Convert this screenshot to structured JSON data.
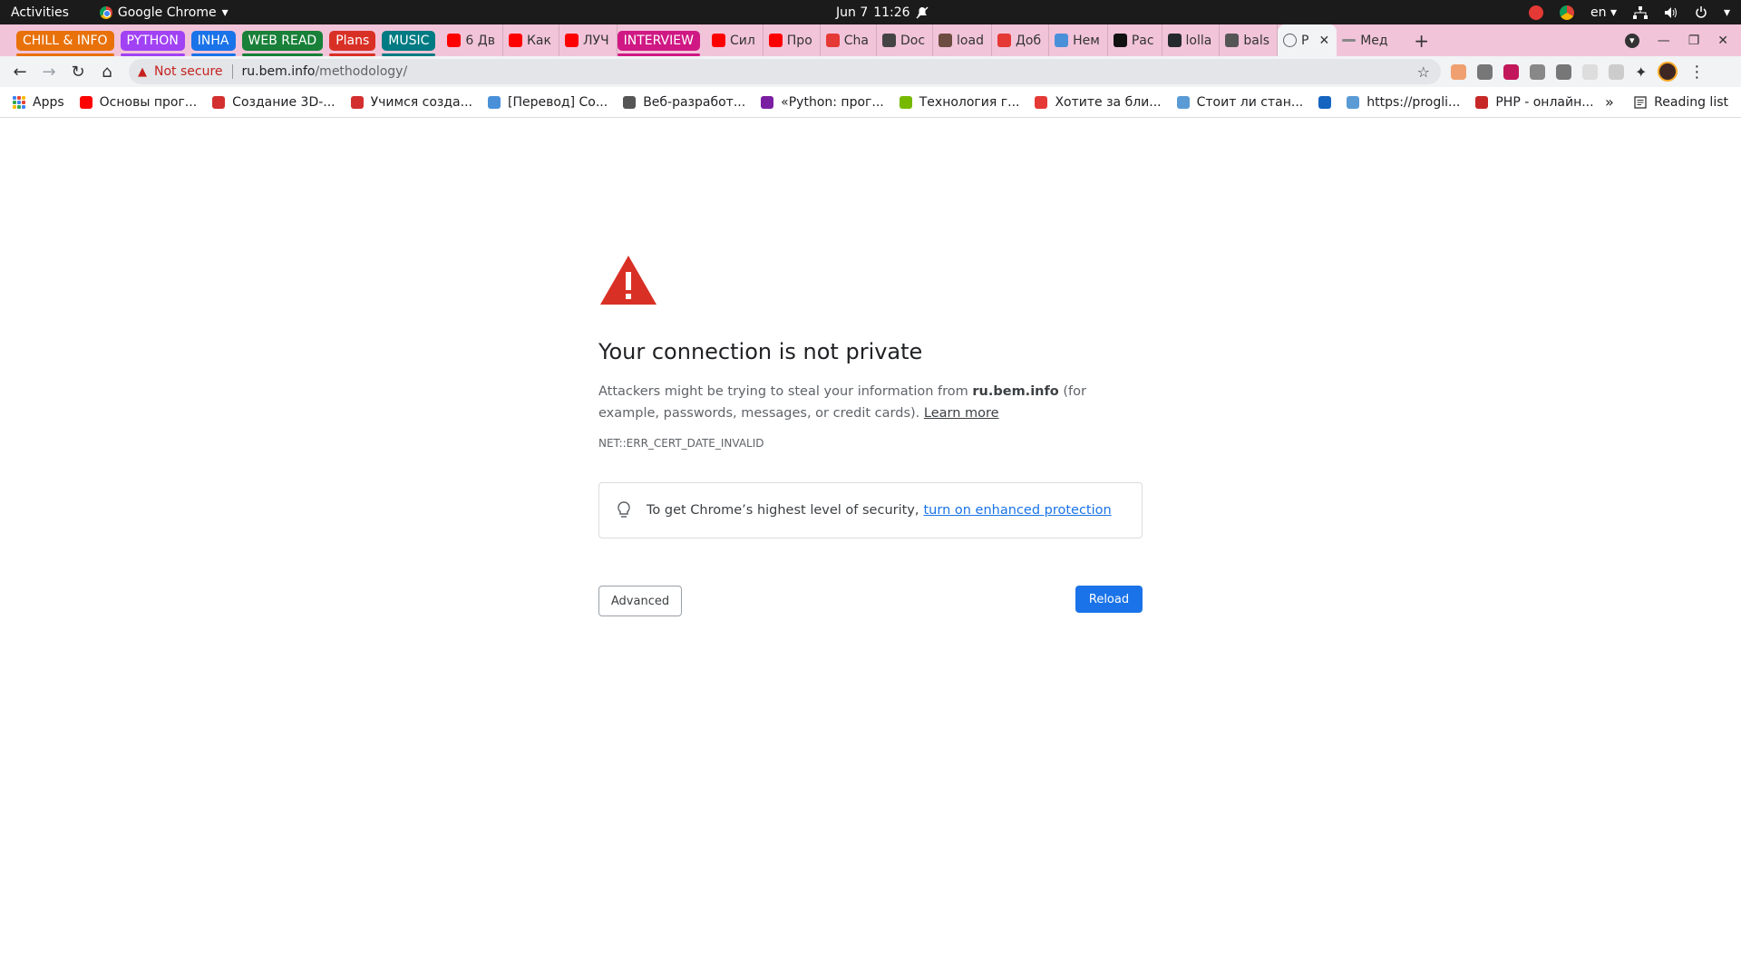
{
  "topbar": {
    "activities": "Activities",
    "app_name": "Google Chrome",
    "app_caret": "▾",
    "date": "Jun 7",
    "time": "11:26",
    "lang": "en",
    "lang_caret": "▾"
  },
  "tabstrip": {
    "groups": [
      {
        "label": "CHILL & INFO",
        "color": "#e8710a"
      },
      {
        "label": "PYTHON",
        "color": "#a142f4"
      },
      {
        "label": "INHA",
        "color": "#1a73e8"
      },
      {
        "label": "WEB READ",
        "color": "#188038"
      },
      {
        "label": "Plans",
        "color": "#d93025"
      },
      {
        "label": "MUSIC",
        "color": "#007b83"
      },
      {
        "label": "INTERVIEW",
        "color": "#d01884"
      }
    ],
    "tabs_after_music": [
      {
        "label": "6 Дв",
        "fav_color": "#ff0000"
      },
      {
        "label": "Как",
        "fav_color": "#ff0000"
      },
      {
        "label": "ЛУЧ",
        "fav_color": "#ff0000"
      }
    ],
    "tabs_after_interview": [
      {
        "label": "Сил",
        "fav_color": "#ff0000"
      },
      {
        "label": "Про",
        "fav_color": "#ff0000"
      },
      {
        "label": "Cha",
        "fav_color": "#e53935"
      },
      {
        "label": "Doc",
        "fav_color": "#444444"
      },
      {
        "label": "load",
        "fav_color": "#6d4c41"
      },
      {
        "label": "Доб",
        "fav_color": "#e53935"
      },
      {
        "label": "Нем",
        "fav_color": "#4a90d9"
      },
      {
        "label": "Рас",
        "fav_color": "#111111"
      },
      {
        "label": "lolla",
        "fav_color": "#24292e"
      },
      {
        "label": "bals",
        "fav_color": "#555555"
      }
    ],
    "active_tab": {
      "label": "P",
      "close": "✕"
    },
    "last_tab": {
      "label": "Мед",
      "fav_color": "#888888"
    },
    "new_tab": "+",
    "window_controls": {
      "search": "▾",
      "minimize": "—",
      "restore": "❐",
      "close": "✕"
    }
  },
  "toolbar": {
    "back": "←",
    "forward": "→",
    "reload": "↻",
    "home": "⌂",
    "security_icon": "▲",
    "security_label": "Not secure",
    "url_host": "ru.bem.info",
    "url_path": "/methodology/",
    "star": "☆",
    "extensions": [
      {
        "name": "ext-1",
        "color": "#f0a070"
      },
      {
        "name": "ext-2",
        "color": "#777777"
      },
      {
        "name": "ext-3",
        "color": "#c2185b"
      },
      {
        "name": "ext-4",
        "color": "#888888"
      },
      {
        "name": "ext-5",
        "color": "#777777"
      },
      {
        "name": "ext-6",
        "color": "#dddddd"
      },
      {
        "name": "ext-7",
        "color": "#cccccc"
      }
    ],
    "puzzle": "✦",
    "menu": "⋮"
  },
  "bookmarks": {
    "apps_label": "Apps",
    "items": [
      {
        "label": "Основы прог...",
        "fav_color": "#ff0000"
      },
      {
        "label": "Создание 3D-...",
        "fav_color": "#d32f2f"
      },
      {
        "label": "Учимся созда...",
        "fav_color": "#d32f2f"
      },
      {
        "label": "[Перевод] Со...",
        "fav_color": "#4a90d9"
      },
      {
        "label": "Веб-разработ...",
        "fav_color": "#555555"
      },
      {
        "label": "«Python: прог...",
        "fav_color": "#7b1fa2"
      },
      {
        "label": "Технология г...",
        "fav_color": "#76b900"
      },
      {
        "label": "Хотите за бли...",
        "fav_color": "#e53935"
      },
      {
        "label": "Стоит ли стан...",
        "fav_color": "#5a9bd5"
      },
      {
        "label": "",
        "fav_color": "#1565c0"
      },
      {
        "label": "https://progli...",
        "fav_color": "#5a9bd5"
      },
      {
        "label": "PHP - онлайн...",
        "fav_color": "#c62828"
      }
    ],
    "more": "»",
    "reading_list": "Reading list"
  },
  "interstitial": {
    "title": "Your connection is not private",
    "desc_before": "Attackers might be trying to steal your information from ",
    "desc_host": "ru.bem.info",
    "desc_after": " (for example, passwords, messages, or credit cards). ",
    "learn_more": "Learn more",
    "error_code": "NET::ERR_CERT_DATE_INVALID",
    "enhanced_text": "To get Chrome’s highest level of security,",
    "enhanced_link": "turn on enhanced protection",
    "advanced_button": "Advanced",
    "reload_button": "Reload",
    "warning_color": "#d93025"
  }
}
